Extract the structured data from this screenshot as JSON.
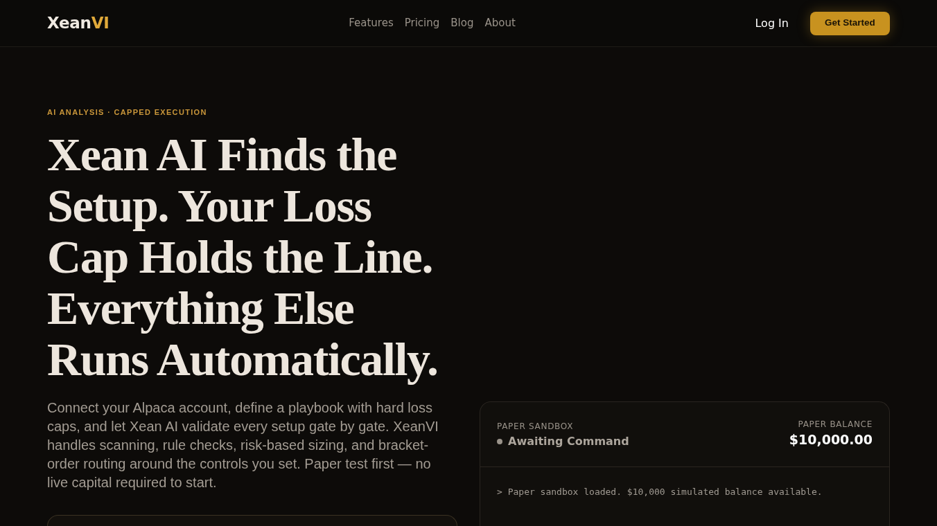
{
  "header": {
    "logo": {
      "text": "Xean",
      "accent": "VI"
    },
    "nav": [
      {
        "label": "Features"
      },
      {
        "label": "Pricing"
      },
      {
        "label": "Blog"
      },
      {
        "label": "About"
      }
    ],
    "login": "Log In",
    "cta": "Get Started"
  },
  "hero": {
    "eyebrow": "AI ANALYSIS · CAPPED EXECUTION",
    "title": "Xean AI Finds the Setup. Your Loss Cap Holds the Line. Everything Else Runs Automatically.",
    "description": "Connect your Alpaca account, define a playbook with hard loss caps, and let Xean AI validate every setup gate by gate. XeanVI handles scanning, rule checks, risk-based sizing, and bracket-order routing around the controls you set. Paper test first — no live capital required to start."
  },
  "sandbox": {
    "label": "PAPER SANDBOX",
    "status": "Awaiting Command",
    "balance_label": "PAPER BALANCE",
    "balance": "$10,000.00",
    "log": [
      "> Paper sandbox loaded. $10,000 simulated balance available."
    ]
  }
}
